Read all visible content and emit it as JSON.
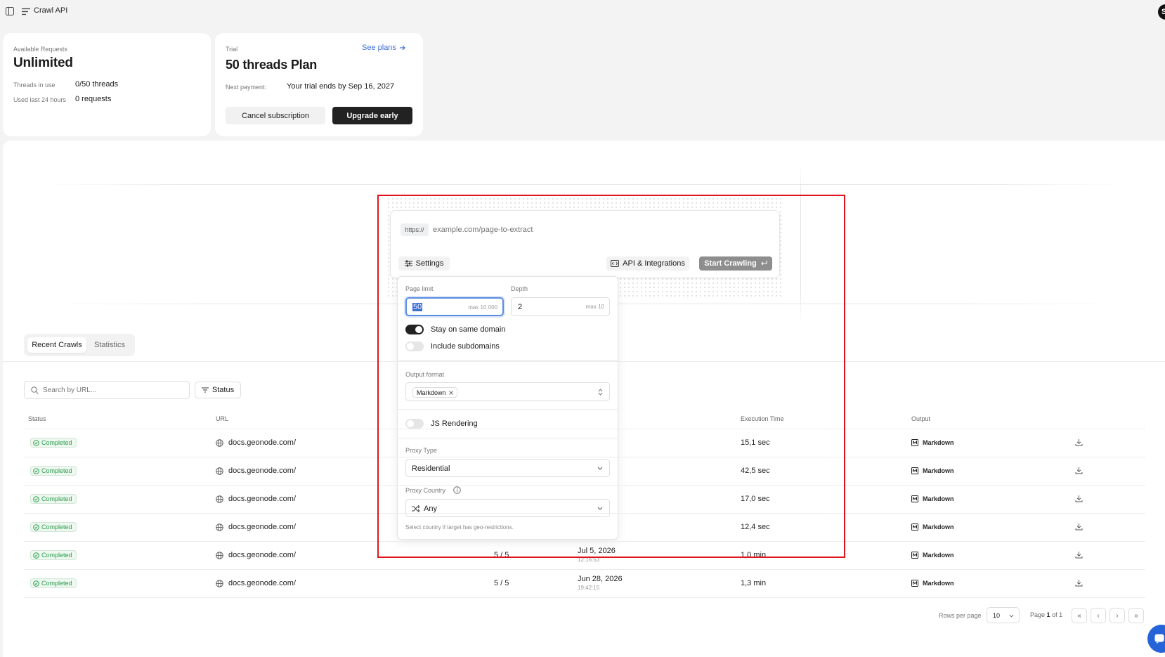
{
  "topbar": {
    "title": "Crawl API",
    "avatar": "S"
  },
  "requests_card": {
    "label": "Available Requests",
    "value": "Unlimited",
    "rows": [
      {
        "label": "Threads in use",
        "value": "0/50 threads"
      },
      {
        "label": "Used last 24 hours",
        "value": "0 requests"
      }
    ]
  },
  "plan_card": {
    "label": "Trial",
    "see_plans": "See plans",
    "title": "50 threads Plan",
    "next_payment_label": "Next payment:",
    "next_payment_value": "Your trial ends by Sep 16, 2027",
    "cancel_label": "Cancel subscription",
    "upgrade_label": "Upgrade early"
  },
  "crawl_input": {
    "prefix": "https://",
    "placeholder": "example.com/page-to-extract",
    "settings_label": "Settings",
    "api_label": "API & Integrations",
    "start_label": "Start Crawling"
  },
  "settings_panel": {
    "page_limit_label": "Page limit",
    "page_limit_value": "50",
    "page_limit_max": "max 10 000",
    "depth_label": "Depth",
    "depth_value": "2",
    "depth_max": "max 10",
    "same_domain_label": "Stay on same domain",
    "same_domain_on": true,
    "subdomains_label": "Include subdomains",
    "subdomains_on": false,
    "output_format_label": "Output format",
    "output_format_chip": "Markdown",
    "js_rendering_label": "JS Rendering",
    "js_rendering_on": false,
    "proxy_type_label": "Proxy Type",
    "proxy_type_value": "Residential",
    "proxy_country_label": "Proxy Country",
    "proxy_country_value": "Any",
    "proxy_country_hint": "Select country if target has geo-restrictions."
  },
  "tabs": {
    "recent": "Recent Crawls",
    "stats": "Statistics"
  },
  "filters": {
    "search_placeholder": "Search by URL...",
    "status_label": "Status"
  },
  "table": {
    "headers": {
      "status": "Status",
      "url": "URL",
      "execution": "Execution Time",
      "output": "Output"
    },
    "rows": [
      {
        "status": "Completed",
        "url": "docs.geonode.com/",
        "pages": "",
        "date": "",
        "time": "",
        "exec": "15,1 sec",
        "output": "Markdown"
      },
      {
        "status": "Completed",
        "url": "docs.geonode.com/",
        "pages": "",
        "date": "",
        "time": "",
        "exec": "42,5 sec",
        "output": "Markdown"
      },
      {
        "status": "Completed",
        "url": "docs.geonode.com/",
        "pages": "",
        "date": "",
        "time": "",
        "exec": "17,0 sec",
        "output": "Markdown"
      },
      {
        "status": "Completed",
        "url": "docs.geonode.com/",
        "pages": "",
        "date": "",
        "time": "",
        "exec": "12,4 sec",
        "output": "Markdown"
      },
      {
        "status": "Completed",
        "url": "docs.geonode.com/",
        "pages": "5 / 5",
        "date": "Jul 5, 2026",
        "time": "12:16:53",
        "exec": "1,0 min",
        "output": "Markdown"
      },
      {
        "status": "Completed",
        "url": "docs.geonode.com/",
        "pages": "5 / 5",
        "date": "Jun 28, 2026",
        "time": "19:42:15",
        "exec": "1,3 min",
        "output": "Markdown"
      }
    ]
  },
  "pagination": {
    "rows_per_page_label": "Rows per page",
    "rows_per_page_value": "10",
    "page_prefix": "Page",
    "page_current": "1",
    "page_of": "of 1",
    "first": "«",
    "prev": "‹",
    "next": "›",
    "last": "»"
  },
  "colors": {
    "highlight": "#e0141e",
    "dark": "#222222",
    "success": "#2a9c4c",
    "accent": "#3b6fd8"
  }
}
